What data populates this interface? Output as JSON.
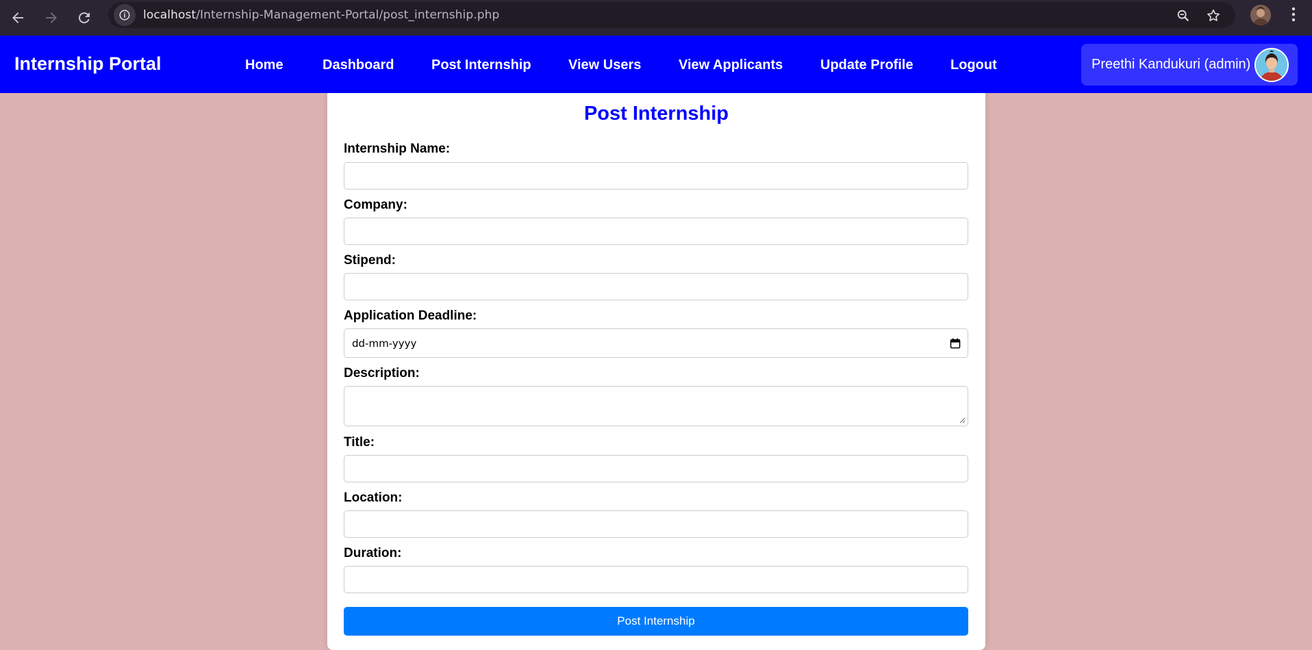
{
  "browser": {
    "url_host": "localhost",
    "url_path": "/Internship-Management-Portal/post_internship.php",
    "back_icon": "arrow-left-icon",
    "forward_icon": "arrow-right-icon",
    "reload_icon": "reload-icon",
    "site_info_icon": "info-icon",
    "zoom_icon": "zoom-icon",
    "bookmark_icon": "star-icon",
    "menu_icon": "kebab-menu-icon"
  },
  "header": {
    "brand": "Internship Portal",
    "nav": [
      {
        "label": "Home"
      },
      {
        "label": "Dashboard"
      },
      {
        "label": "Post Internship"
      },
      {
        "label": "View Users"
      },
      {
        "label": "View Applicants"
      },
      {
        "label": "Update Profile"
      },
      {
        "label": "Logout"
      }
    ],
    "user": {
      "name": "Preethi Kandukuri (admin)",
      "avatar_icon": "user-avatar-icon"
    },
    "colors": {
      "background": "#0000ff",
      "user_box": "#3333ff"
    }
  },
  "form": {
    "title": "Post Internship",
    "fields": [
      {
        "label": "Internship Name:",
        "value": ""
      },
      {
        "label": "Company:",
        "value": ""
      },
      {
        "label": "Stipend:",
        "value": ""
      },
      {
        "label": "Application Deadline:",
        "placeholder": "dd-mm-yyyy"
      },
      {
        "label": "Description:",
        "value": ""
      },
      {
        "label": "Title:",
        "value": ""
      },
      {
        "label": "Location:",
        "value": ""
      },
      {
        "label": "Duration:",
        "value": ""
      }
    ],
    "submit_label": "Post Internship",
    "colors": {
      "title": "#0000ff",
      "submit": "#007bff",
      "page_background": "#dcb1b2"
    }
  }
}
